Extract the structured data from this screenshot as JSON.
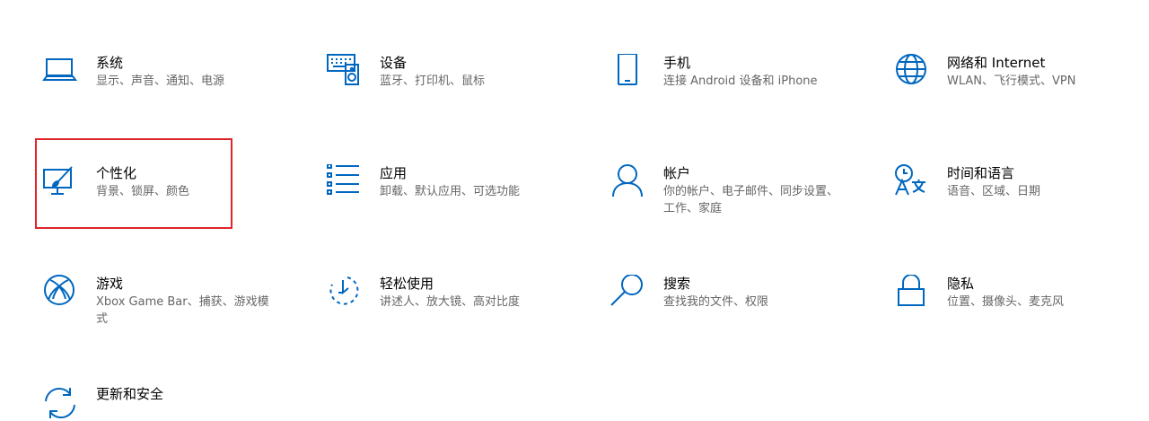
{
  "colors": {
    "accent": "#0067c0",
    "title": "#000000",
    "description": "#666666",
    "highlight": "#e0262b"
  },
  "tiles": [
    {
      "title": "系统",
      "desc": "显示、声音、通知、电源",
      "icon": "laptop-icon"
    },
    {
      "title": "设备",
      "desc": "蓝牙、打印机、鼠标",
      "icon": "keyboard-speaker-icon"
    },
    {
      "title": "手机",
      "desc": "连接 Android 设备和 iPhone",
      "icon": "phone-icon"
    },
    {
      "title": "网络和 Internet",
      "desc": "WLAN、飞行模式、VPN",
      "icon": "globe-icon"
    },
    {
      "title": "个性化",
      "desc": "背景、锁屏、颜色",
      "icon": "paint-monitor-icon"
    },
    {
      "title": "应用",
      "desc": "卸载、默认应用、可选功能",
      "icon": "app-list-icon"
    },
    {
      "title": "帐户",
      "desc": "你的帐户、电子邮件、同步设置、工作、家庭",
      "icon": "person-icon"
    },
    {
      "title": "时间和语言",
      "desc": "语音、区域、日期",
      "icon": "time-language-icon"
    },
    {
      "title": "游戏",
      "desc": "Xbox Game Bar、捕获、游戏模式",
      "icon": "xbox-icon"
    },
    {
      "title": "轻松使用",
      "desc": "讲述人、放大镜、高对比度",
      "icon": "ease-of-access-icon"
    },
    {
      "title": "搜索",
      "desc": "查找我的文件、权限",
      "icon": "search-icon"
    },
    {
      "title": "隐私",
      "desc": "位置、摄像头、麦克风",
      "icon": "lock-icon"
    },
    {
      "title": "更新和安全",
      "desc": "",
      "icon": "sync-icon"
    }
  ]
}
